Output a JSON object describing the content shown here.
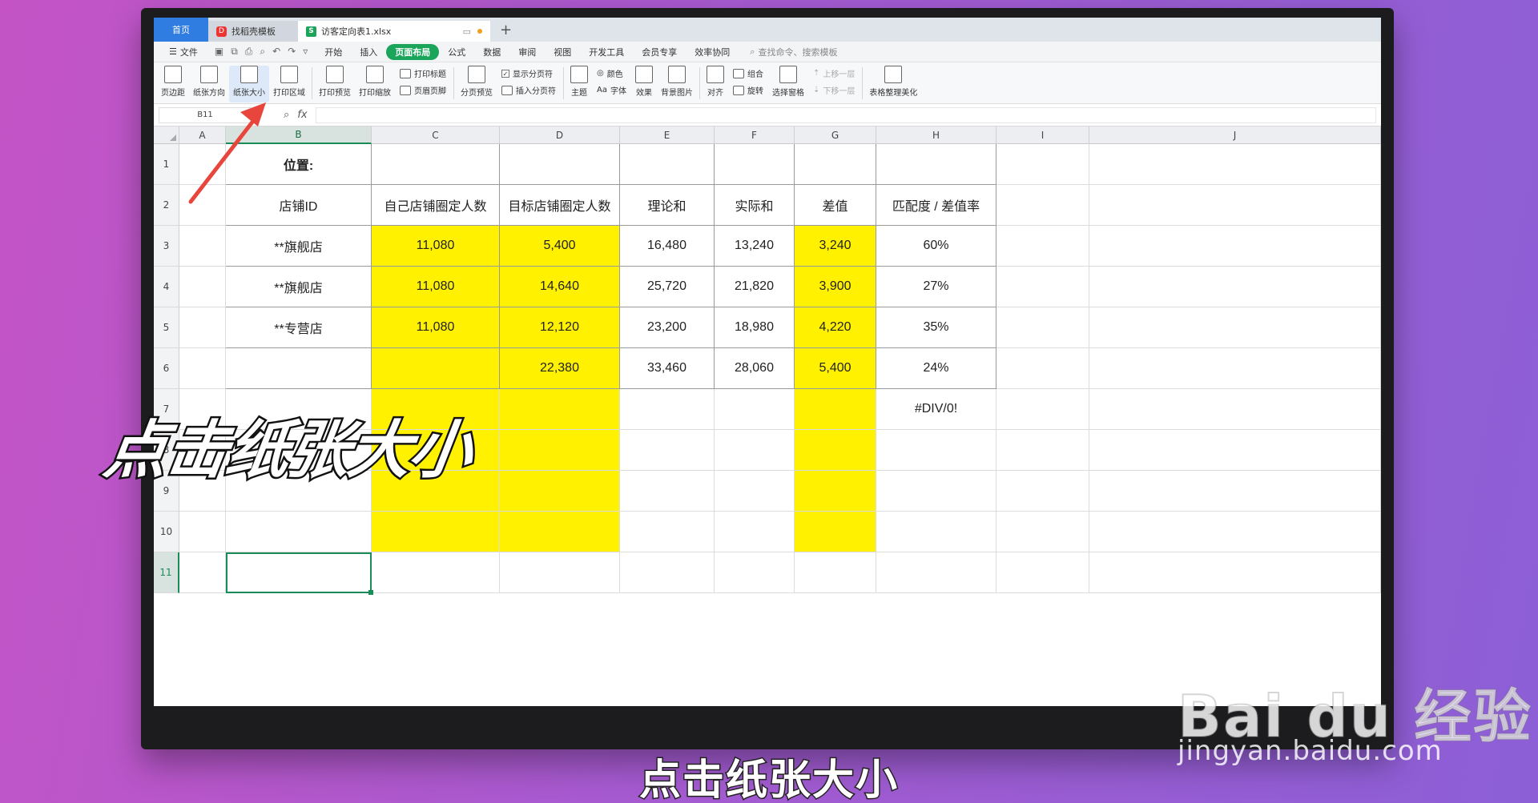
{
  "tabs": {
    "home": "首页",
    "template": "找稻壳模板",
    "file": "访客定向表1.xlsx",
    "new_tab": "+"
  },
  "menu": {
    "file": "文件",
    "items": [
      "开始",
      "插入",
      "页面布局",
      "公式",
      "数据",
      "审阅",
      "视图",
      "开发工具",
      "会员专享",
      "效率协同"
    ],
    "active_index": 2,
    "search_placeholder": "查找命令、搜索模板"
  },
  "ribbon": {
    "margins": "页边距",
    "orientation": "纸张方向",
    "paper_size": "纸张大小",
    "print_area": "打印区域",
    "print_preview": "打印预览",
    "print_scale": "打印缩放",
    "print_titles": "打印标题",
    "header_footer": "页眉页脚",
    "page_break_preview": "分页预览",
    "show_page_breaks": "显示分页符",
    "insert_page_break": "插入分页符",
    "theme": "主题",
    "colors": "颜色",
    "fonts": "字体",
    "fonts_prefix": "Aa",
    "effects": "效果",
    "background": "背景图片",
    "align": "对齐",
    "group": "组合",
    "rotate": "旋转",
    "selection_pane": "选择窗格",
    "bring_forward": "上移一层",
    "send_backward": "下移一层",
    "table_beautify": "表格整理美化"
  },
  "formula_bar": {
    "name_box": "B11",
    "fx": "fx",
    "content": ""
  },
  "columns": [
    "A",
    "B",
    "C",
    "D",
    "E",
    "F",
    "G",
    "H",
    "I",
    "J"
  ],
  "rows": [
    "1",
    "2",
    "3",
    "4",
    "5",
    "6",
    "7",
    "8",
    "9",
    "10",
    "11"
  ],
  "sheet": {
    "r1": {
      "B": "位置:"
    },
    "r2": {
      "B": "店铺ID",
      "C": "自己店铺圈定人数",
      "D": "目标店铺圈定人数",
      "E": "理论和",
      "F": "实际和",
      "G": "差值",
      "H": "匹配度 / 差值率"
    },
    "r3": {
      "B": "**旗舰店",
      "C": "11,080",
      "D": "5,400",
      "E": "16,480",
      "F": "13,240",
      "G": "3,240",
      "H": "60%"
    },
    "r4": {
      "B": "**旗舰店",
      "C": "11,080",
      "D": "14,640",
      "E": "25,720",
      "F": "21,820",
      "G": "3,900",
      "H": "27%"
    },
    "r5": {
      "B": "**专营店",
      "C": "11,080",
      "D": "12,120",
      "E": "23,200",
      "F": "18,980",
      "G": "4,220",
      "H": "35%"
    },
    "r6": {
      "B": "",
      "C": "",
      "D": "22,380",
      "E": "33,460",
      "F": "28,060",
      "G": "5,400",
      "H": "24%"
    },
    "r7": {
      "H": "#DIV/0!"
    }
  },
  "colors": {
    "highlight": "#fff100",
    "accent": "#1aa55a",
    "arrow": "#e8453c"
  },
  "overlay_caption": "点击纸张大小",
  "subtitle": "点击纸张大小",
  "watermark": {
    "brand": "Bai du 经验",
    "url": "jingyan.baidu.com"
  }
}
